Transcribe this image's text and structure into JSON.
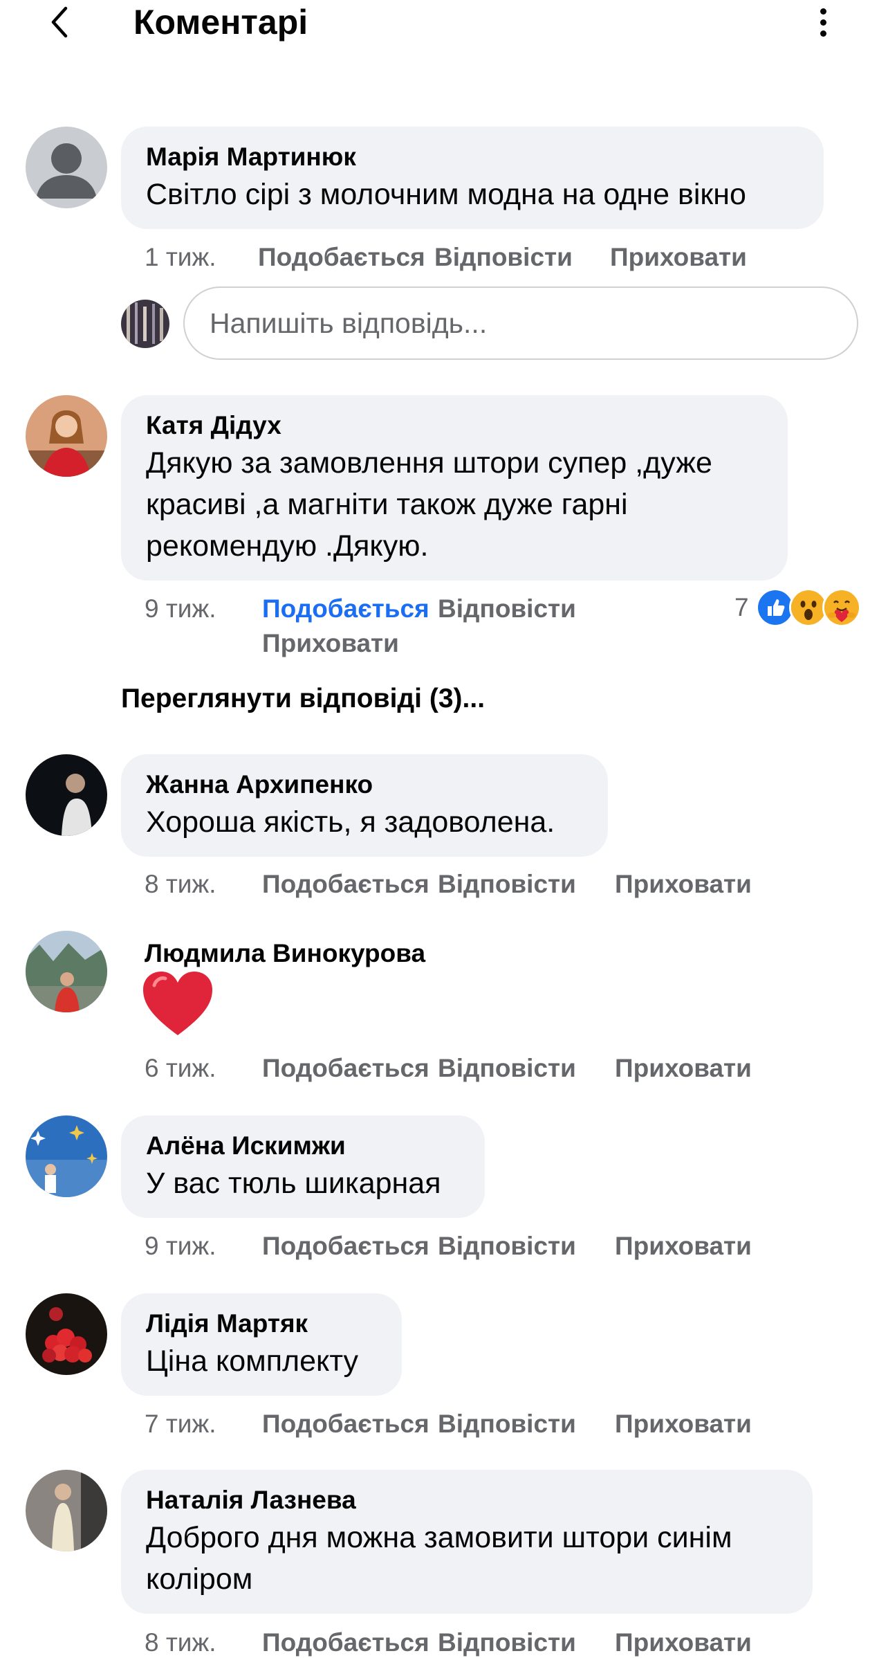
{
  "header": {
    "title": "Коментарі",
    "back_icon": "chevron-left-icon",
    "more_icon": "more-vertical-icon"
  },
  "reply_box": {
    "placeholder": "Напишіть відповідь..."
  },
  "view_replies": "Переглянути відповіді (3)...",
  "actions": {
    "like": "Подобається",
    "reply": "Відповісти",
    "hide": "Приховати"
  },
  "comments": [
    {
      "author": "Марія Мартинюк",
      "text": "Світло сірі з молочним модна на одне вікно",
      "time": "1 тиж."
    },
    {
      "author": "Катя Дідух",
      "text": "Дякую за замовлення штори супер ,дуже красиві ,а магніти також дуже гарні рекомендую .Дякую.",
      "time": "9 тиж.",
      "liked": true,
      "reaction_count": "7",
      "reactions": [
        "like",
        "wow",
        "care"
      ]
    },
    {
      "author": "Жанна Архипенко",
      "text": "Хороша якість, я задоволена.",
      "time": "8 тиж."
    },
    {
      "author": "Людмила Винокурова",
      "text": "",
      "emoji": "red-heart",
      "time": "6 тиж."
    },
    {
      "author": "Алёна Искимжи",
      "text": "У вас тюль шикарная",
      "time": "9 тиж."
    },
    {
      "author": "Лідія Мартяк",
      "text": "Ціна комплекту",
      "time": "7 тиж."
    },
    {
      "author": "Наталія Лазнева",
      "text": "Доброго дня можна замовити штори синім коліром",
      "time": "8 тиж."
    }
  ],
  "colors": {
    "accent": "#1b6ef3",
    "bubble": "#f0f2f5",
    "muted": "#65676b",
    "heart": "#e0243a"
  }
}
